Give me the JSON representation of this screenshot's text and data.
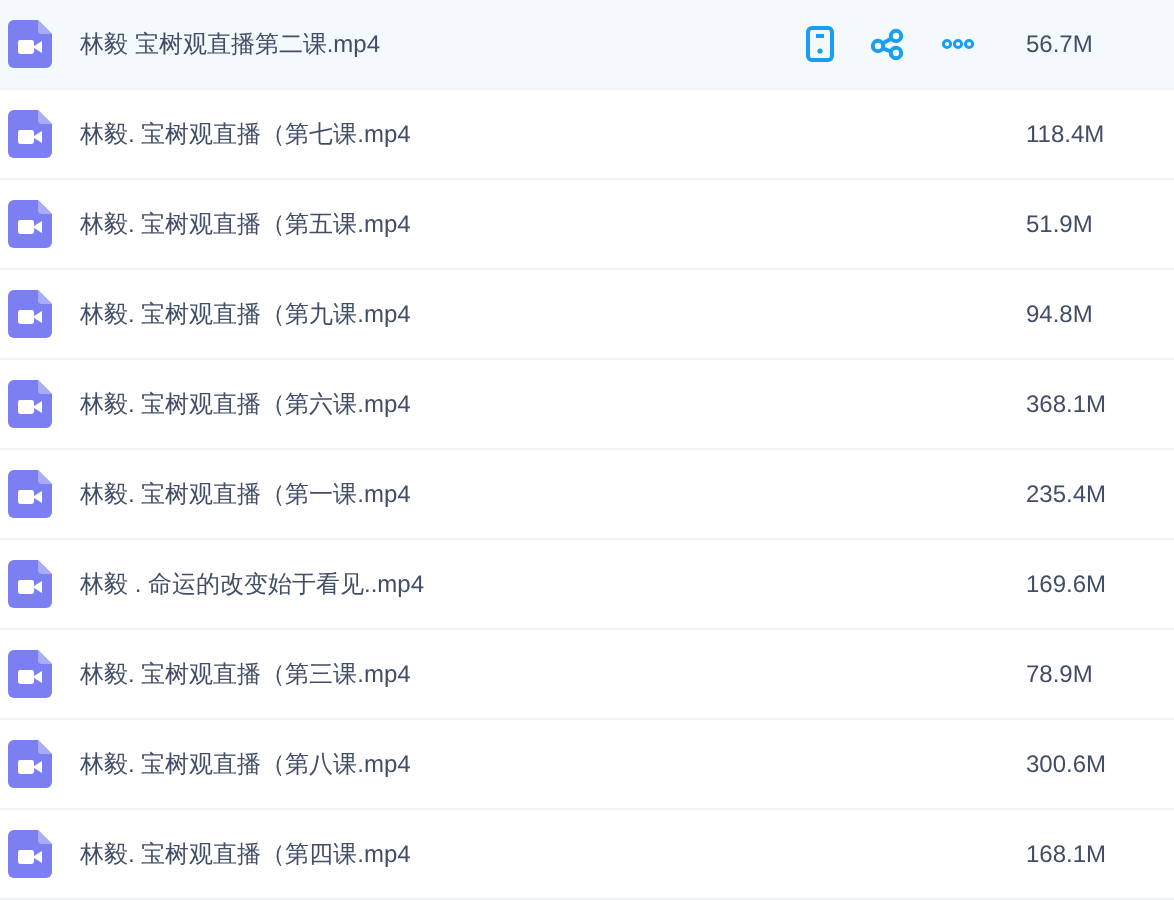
{
  "files": [
    {
      "name": "林毅 宝树观直播第二课.mp4",
      "size": "56.7M",
      "selected": true
    },
    {
      "name": "林毅. 宝树观直播（第七课.mp4",
      "size": "118.4M",
      "selected": false
    },
    {
      "name": "林毅. 宝树观直播（第五课.mp4",
      "size": "51.9M",
      "selected": false
    },
    {
      "name": "林毅. 宝树观直播（第九课.mp4",
      "size": "94.8M",
      "selected": false
    },
    {
      "name": "林毅. 宝树观直播（第六课.mp4",
      "size": "368.1M",
      "selected": false
    },
    {
      "name": "林毅. 宝树观直播（第一课.mp4",
      "size": "235.4M",
      "selected": false
    },
    {
      "name": "林毅 . 命运的改变始于看见..mp4",
      "size": "169.6M",
      "selected": false
    },
    {
      "name": "林毅. 宝树观直播（第三课.mp4",
      "size": "78.9M",
      "selected": false
    },
    {
      "name": "林毅. 宝树观直播（第八课.mp4",
      "size": "300.6M",
      "selected": false
    },
    {
      "name": "林毅. 宝树观直播（第四课.mp4",
      "size": "168.1M",
      "selected": false
    }
  ]
}
